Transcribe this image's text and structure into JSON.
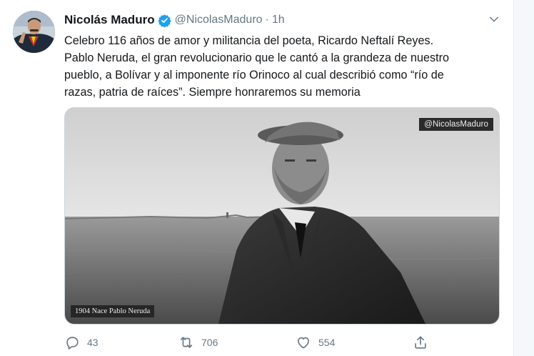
{
  "tweet": {
    "display_name": "Nicolás Maduro",
    "handle": "@NicolasMaduro",
    "separator": "·",
    "time": "1h",
    "verified": true,
    "text_lines": [
      "Celebro 116 años de amor y militancia del poeta, Ricardo Neftalí Reyes.",
      "Pablo Neruda, el gran revolucionario que le cantó a la grandeza de nuestro",
      "pueblo, a Bolívar y al imponente río Orinoco al cual describió como “río de",
      "razas, patria de raíces”. Siempre honraremos su memoria"
    ],
    "media": {
      "watermark": "@NicolasMaduro",
      "caption": "1904 Nace Pablo Neruda"
    },
    "actions": {
      "reply_count": "43",
      "retweet_count": "706",
      "like_count": "554"
    }
  },
  "icons": {
    "avatar": "avatar",
    "verified": "verified-badge-icon",
    "caret": "chevron-down-icon",
    "reply": "reply-icon",
    "retweet": "retweet-icon",
    "like": "heart-icon",
    "share": "share-icon"
  },
  "colors": {
    "text": "#14171a",
    "secondary": "#657786",
    "verified": "#1da1f2",
    "border": "#e6ecf0"
  }
}
